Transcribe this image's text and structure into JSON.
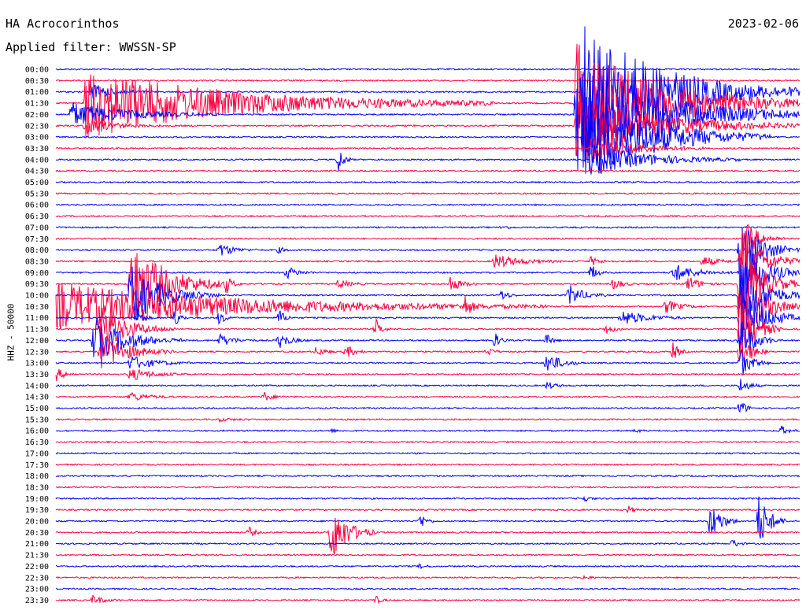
{
  "header": {
    "station": "HA Acrocorinthos",
    "filter_label": "Applied filter: WWSSN-SP",
    "date": "2023-02-06"
  },
  "chart_data": {
    "type": "line",
    "title": "HA Acrocorinthos",
    "subtitle": "Applied filter: WWSSN-SP",
    "date": "2023-02-06",
    "ylabel": "HHZ - 50000",
    "xlabel": "",
    "row_interval_minutes": 30,
    "colors": [
      "#0000ff",
      "#ff0040"
    ],
    "rows": [
      {
        "label": "00:00",
        "color": "#0000ff",
        "events": []
      },
      {
        "label": "00:30",
        "color": "#ff0040",
        "events": []
      },
      {
        "label": "01:00",
        "color": "#0000ff",
        "events": [
          {
            "t": 0.05,
            "amp": 10,
            "dur": 0.08
          },
          {
            "t": 0.71,
            "amp": 90,
            "dur": 0.29
          }
        ]
      },
      {
        "label": "01:30",
        "color": "#ff0040",
        "events": [
          {
            "t": 0.04,
            "amp": 45,
            "dur": 0.55
          },
          {
            "t": 0.7,
            "amp": 85,
            "dur": 0.3
          }
        ]
      },
      {
        "label": "02:00",
        "color": "#0000ff",
        "events": [
          {
            "t": 0.02,
            "amp": 16,
            "dur": 0.2
          },
          {
            "t": 0.7,
            "amp": 75,
            "dur": 0.3
          }
        ]
      },
      {
        "label": "02:30",
        "color": "#ff0040",
        "events": [
          {
            "t": 0.04,
            "amp": 10,
            "dur": 0.1
          },
          {
            "t": 0.7,
            "amp": 40,
            "dur": 0.3
          }
        ]
      },
      {
        "label": "03:00",
        "color": "#0000ff",
        "events": [
          {
            "t": 0.71,
            "amp": 60,
            "dur": 0.25
          }
        ]
      },
      {
        "label": "03:30",
        "color": "#ff0040",
        "events": [
          {
            "t": 0.72,
            "amp": 20,
            "dur": 0.15
          }
        ]
      },
      {
        "label": "04:00",
        "color": "#0000ff",
        "events": [
          {
            "t": 0.38,
            "amp": 16,
            "dur": 0.02
          },
          {
            "t": 0.72,
            "amp": 20,
            "dur": 0.2
          }
        ]
      },
      {
        "label": "04:30",
        "color": "#ff0040",
        "events": []
      },
      {
        "label": "05:00",
        "color": "#0000ff",
        "events": []
      },
      {
        "label": "05:30",
        "color": "#ff0040",
        "events": []
      },
      {
        "label": "06:00",
        "color": "#0000ff",
        "events": []
      },
      {
        "label": "06:30",
        "color": "#ff0040",
        "events": []
      },
      {
        "label": "07:00",
        "color": "#0000ff",
        "events": [
          {
            "t": 0.6,
            "amp": 3,
            "dur": 0.02
          }
        ]
      },
      {
        "label": "07:30",
        "color": "#ff0040",
        "events": [
          {
            "t": 0.93,
            "amp": 20,
            "dur": 0.05
          }
        ]
      },
      {
        "label": "08:00",
        "color": "#0000ff",
        "events": [
          {
            "t": 0.22,
            "amp": 9,
            "dur": 0.05
          },
          {
            "t": 0.3,
            "amp": 4,
            "dur": 0.02
          },
          {
            "t": 0.92,
            "amp": 40,
            "dur": 0.08
          }
        ]
      },
      {
        "label": "08:30",
        "color": "#ff0040",
        "events": [
          {
            "t": 0.59,
            "amp": 9,
            "dur": 0.09
          },
          {
            "t": 0.72,
            "amp": 6,
            "dur": 0.03
          },
          {
            "t": 0.87,
            "amp": 7,
            "dur": 0.05
          },
          {
            "t": 0.92,
            "amp": 45,
            "dur": 0.08
          }
        ]
      },
      {
        "label": "09:00",
        "color": "#0000ff",
        "events": [
          {
            "t": 0.31,
            "amp": 8,
            "dur": 0.04
          },
          {
            "t": 0.72,
            "amp": 12,
            "dur": 0.02
          },
          {
            "t": 0.83,
            "amp": 12,
            "dur": 0.08
          },
          {
            "t": 0.92,
            "amp": 50,
            "dur": 0.08
          }
        ]
      },
      {
        "label": "09:30",
        "color": "#ff0040",
        "events": [
          {
            "t": 0.1,
            "amp": 60,
            "dur": 0.13
          },
          {
            "t": 0.23,
            "amp": 12,
            "dur": 0.02
          },
          {
            "t": 0.38,
            "amp": 6,
            "dur": 0.04
          },
          {
            "t": 0.53,
            "amp": 10,
            "dur": 0.04
          },
          {
            "t": 0.75,
            "amp": 8,
            "dur": 0.03
          },
          {
            "t": 0.85,
            "amp": 10,
            "dur": 0.04
          },
          {
            "t": 0.92,
            "amp": 55,
            "dur": 0.08
          }
        ]
      },
      {
        "label": "10:00",
        "color": "#0000ff",
        "events": [
          {
            "t": 0.1,
            "amp": 40,
            "dur": 0.12
          },
          {
            "t": 0.6,
            "amp": 8,
            "dur": 0.02
          },
          {
            "t": 0.69,
            "amp": 14,
            "dur": 0.05
          },
          {
            "t": 0.92,
            "amp": 55,
            "dur": 0.08
          }
        ]
      },
      {
        "label": "10:30",
        "color": "#ff0040",
        "events": [
          {
            "t": 0.0,
            "amp": 30,
            "dur": 0.66
          },
          {
            "t": 0.55,
            "amp": 14,
            "dur": 0.02
          },
          {
            "t": 0.82,
            "amp": 9,
            "dur": 0.05
          },
          {
            "t": 0.92,
            "amp": 50,
            "dur": 0.08
          }
        ]
      },
      {
        "label": "11:00",
        "color": "#0000ff",
        "events": [
          {
            "t": 0.11,
            "amp": 12,
            "dur": 0.02
          },
          {
            "t": 0.16,
            "amp": 12,
            "dur": 0.02
          },
          {
            "t": 0.22,
            "amp": 10,
            "dur": 0.02
          },
          {
            "t": 0.3,
            "amp": 12,
            "dur": 0.02
          },
          {
            "t": 0.76,
            "amp": 10,
            "dur": 0.09
          },
          {
            "t": 0.92,
            "amp": 45,
            "dur": 0.08
          }
        ]
      },
      {
        "label": "11:30",
        "color": "#ff0040",
        "events": [
          {
            "t": 0.06,
            "amp": 30,
            "dur": 0.1
          },
          {
            "t": 0.43,
            "amp": 13,
            "dur": 0.02
          },
          {
            "t": 0.74,
            "amp": 6,
            "dur": 0.03
          },
          {
            "t": 0.92,
            "amp": 40,
            "dur": 0.06
          }
        ]
      },
      {
        "label": "12:00",
        "color": "#0000ff",
        "events": [
          {
            "t": 0.05,
            "amp": 30,
            "dur": 0.12
          },
          {
            "t": 0.22,
            "amp": 8,
            "dur": 0.05
          },
          {
            "t": 0.3,
            "amp": 10,
            "dur": 0.04
          },
          {
            "t": 0.59,
            "amp": 10,
            "dur": 0.02
          },
          {
            "t": 0.66,
            "amp": 8,
            "dur": 0.02
          },
          {
            "t": 0.92,
            "amp": 30,
            "dur": 0.05
          }
        ]
      },
      {
        "label": "12:30",
        "color": "#ff0040",
        "events": [
          {
            "t": 0.06,
            "amp": 25,
            "dur": 0.1
          },
          {
            "t": 0.35,
            "amp": 6,
            "dur": 0.03
          },
          {
            "t": 0.39,
            "amp": 9,
            "dur": 0.03
          },
          {
            "t": 0.58,
            "amp": 6,
            "dur": 0.02
          },
          {
            "t": 0.83,
            "amp": 12,
            "dur": 0.02
          },
          {
            "t": 0.92,
            "amp": 25,
            "dur": 0.04
          }
        ]
      },
      {
        "label": "13:00",
        "color": "#0000ff",
        "events": [
          {
            "t": 0.1,
            "amp": 10,
            "dur": 0.08
          },
          {
            "t": 0.66,
            "amp": 14,
            "dur": 0.05
          },
          {
            "t": 0.92,
            "amp": 20,
            "dur": 0.04
          }
        ]
      },
      {
        "label": "13:30",
        "color": "#ff0040",
        "events": [
          {
            "t": 0.0,
            "amp": 9,
            "dur": 0.03
          },
          {
            "t": 0.1,
            "amp": 8,
            "dur": 0.08
          }
        ]
      },
      {
        "label": "14:00",
        "color": "#0000ff",
        "events": [
          {
            "t": 0.66,
            "amp": 5,
            "dur": 0.03
          },
          {
            "t": 0.92,
            "amp": 10,
            "dur": 0.03
          }
        ]
      },
      {
        "label": "14:30",
        "color": "#ff0040",
        "events": [
          {
            "t": 0.28,
            "amp": 6,
            "dur": 0.03
          },
          {
            "t": 0.1,
            "amp": 6,
            "dur": 0.06
          }
        ]
      },
      {
        "label": "15:00",
        "color": "#0000ff",
        "events": [
          {
            "t": 0.92,
            "amp": 12,
            "dur": 0.02
          }
        ]
      },
      {
        "label": "15:30",
        "color": "#ff0040",
        "events": [
          {
            "t": 0.22,
            "amp": 2,
            "dur": 0.05
          }
        ]
      },
      {
        "label": "16:00",
        "color": "#0000ff",
        "events": [
          {
            "t": 0.37,
            "amp": 2,
            "dur": 0.02
          },
          {
            "t": 0.78,
            "amp": 2,
            "dur": 0.02
          },
          {
            "t": 0.975,
            "amp": 6,
            "dur": 0.025
          }
        ]
      },
      {
        "label": "16:30",
        "color": "#ff0040",
        "events": []
      },
      {
        "label": "17:00",
        "color": "#0000ff",
        "events": []
      },
      {
        "label": "17:30",
        "color": "#ff0040",
        "events": []
      },
      {
        "label": "18:00",
        "color": "#0000ff",
        "events": []
      },
      {
        "label": "18:30",
        "color": "#ff0040",
        "events": []
      },
      {
        "label": "19:00",
        "color": "#0000ff",
        "events": [
          {
            "t": 0.71,
            "amp": 4,
            "dur": 0.02
          }
        ]
      },
      {
        "label": "19:30",
        "color": "#ff0040",
        "events": [
          {
            "t": 0.77,
            "amp": 5,
            "dur": 0.02
          }
        ]
      },
      {
        "label": "20:00",
        "color": "#0000ff",
        "events": [
          {
            "t": 0.49,
            "amp": 10,
            "dur": 0.02
          },
          {
            "t": 0.88,
            "amp": 25,
            "dur": 0.04
          },
          {
            "t": 0.945,
            "amp": 35,
            "dur": 0.04
          }
        ]
      },
      {
        "label": "20:30",
        "color": "#ff0040",
        "events": [
          {
            "t": 0.26,
            "amp": 7,
            "dur": 0.02
          },
          {
            "t": 0.37,
            "amp": 40,
            "dur": 0.06
          }
        ]
      },
      {
        "label": "21:00",
        "color": "#0000ff",
        "events": [
          {
            "t": 0.91,
            "amp": 6,
            "dur": 0.02
          }
        ]
      },
      {
        "label": "21:30",
        "color": "#ff0040",
        "events": []
      },
      {
        "label": "22:00",
        "color": "#0000ff",
        "events": [
          {
            "t": 0.49,
            "amp": 3,
            "dur": 0.02
          }
        ]
      },
      {
        "label": "22:30",
        "color": "#ff0040",
        "events": [
          {
            "t": 0.71,
            "amp": 3,
            "dur": 0.02
          }
        ]
      },
      {
        "label": "23:00",
        "color": "#0000ff",
        "events": []
      },
      {
        "label": "23:30",
        "color": "#ff0040",
        "events": [
          {
            "t": 0.05,
            "amp": 6,
            "dur": 0.04
          },
          {
            "t": 0.43,
            "amp": 5,
            "dur": 0.02
          }
        ]
      }
    ]
  }
}
